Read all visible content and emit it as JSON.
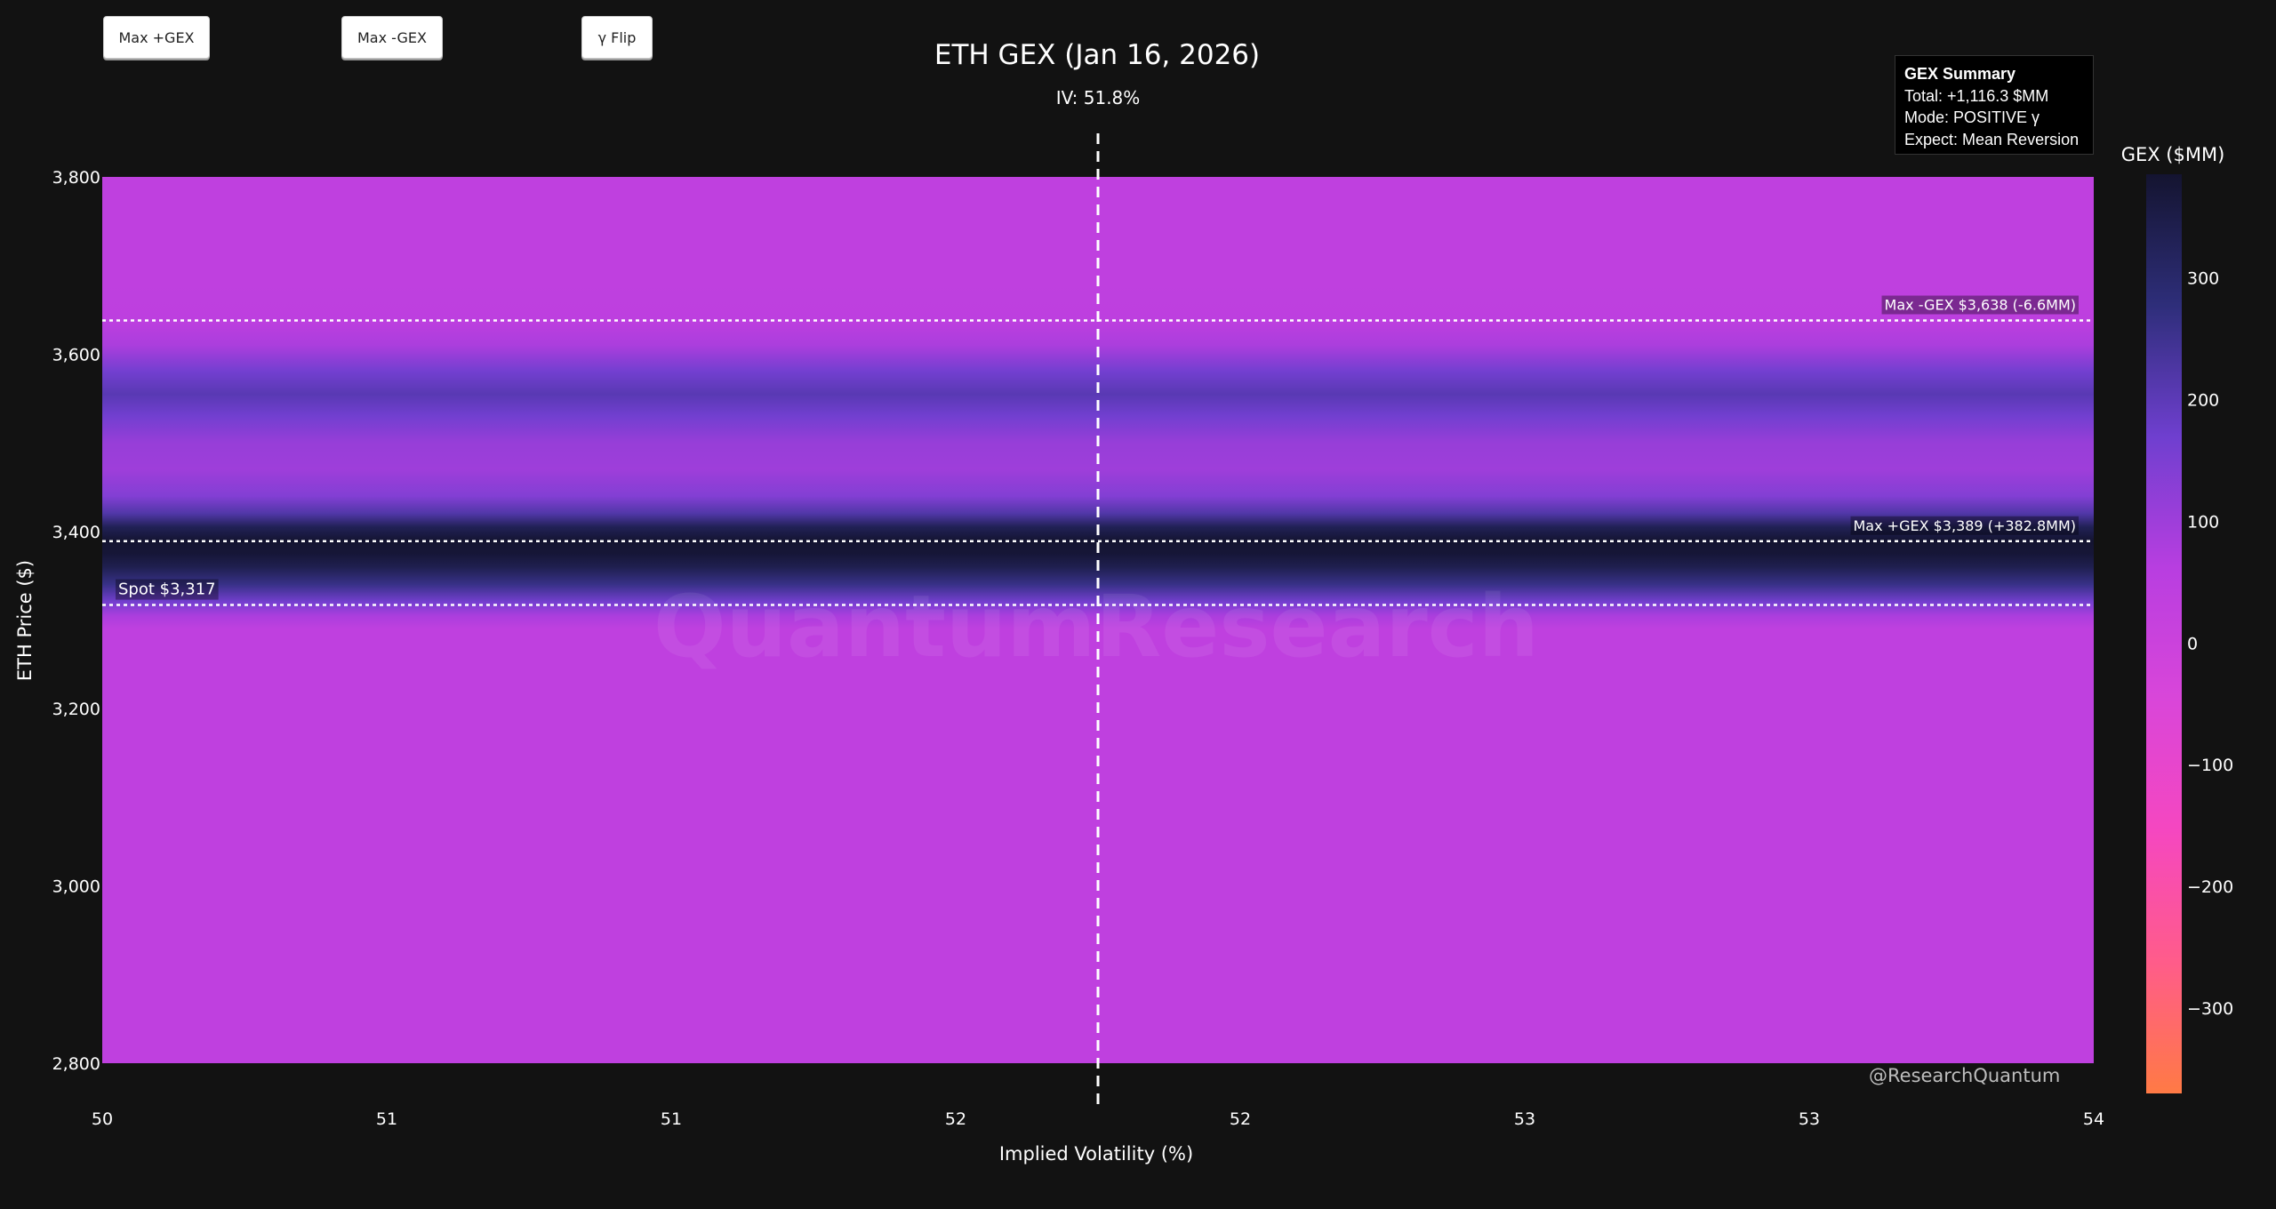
{
  "toolbar": {
    "max_pos_label": "Max +GEX",
    "max_neg_label": "Max -GEX",
    "flip_label": "γ Flip"
  },
  "summary": {
    "header": "GEX Summary",
    "total": "Total: +1,116.3 $MM",
    "mode": "Mode: POSITIVE γ",
    "expect": "Expect: Mean Reversion"
  },
  "watermark": {
    "center": "QuantumResearch",
    "handle": "@ResearchQuantum"
  },
  "colorbar": {
    "title": "GEX ($MM)",
    "ticks": [
      "300",
      "200",
      "100",
      "0",
      "−100",
      "−200",
      "−300"
    ],
    "tick_values": [
      300,
      200,
      100,
      0,
      -100,
      -200,
      -300
    ],
    "range": [
      -370,
      385
    ],
    "colors": [
      "#ff7a45",
      "#ff5c8a",
      "#f547c0",
      "#d946d9",
      "#b83ee0",
      "#6f3fcf",
      "#2e2e7a",
      "#141430"
    ]
  },
  "chart_data": {
    "type": "heatmap",
    "title": "ETH GEX (Jan 16, 2026)",
    "subtitle": "IV: 51.8%",
    "xlabel": "Implied Volatility (%)",
    "ylabel": "ETH Price ($)",
    "xlim": [
      50.0,
      53.5
    ],
    "ylim": [
      2800,
      3800
    ],
    "x_tick_labels": [
      "50",
      "51",
      "51",
      "52",
      "52",
      "53",
      "53",
      "54"
    ],
    "y_ticks": [
      2800,
      3000,
      3200,
      3400,
      3600,
      3800
    ],
    "y_tick_labels": [
      "2,800",
      "3,000",
      "3,200",
      "3,400",
      "3,600",
      "3,800"
    ],
    "iv_marker": 51.75,
    "gex_profile": [
      {
        "price": 2800,
        "gex": 40
      },
      {
        "price": 3290,
        "gex": 40
      },
      {
        "price": 3305,
        "gex": 80
      },
      {
        "price": 3320,
        "gex": 160
      },
      {
        "price": 3340,
        "gex": 260
      },
      {
        "price": 3360,
        "gex": 340
      },
      {
        "price": 3375,
        "gex": 375
      },
      {
        "price": 3389,
        "gex": 383
      },
      {
        "price": 3405,
        "gex": 330
      },
      {
        "price": 3420,
        "gex": 220
      },
      {
        "price": 3440,
        "gex": 140
      },
      {
        "price": 3470,
        "gex": 100
      },
      {
        "price": 3500,
        "gex": 110
      },
      {
        "price": 3530,
        "gex": 165
      },
      {
        "price": 3555,
        "gex": 205
      },
      {
        "price": 3580,
        "gex": 165
      },
      {
        "price": 3610,
        "gex": 80
      },
      {
        "price": 3638,
        "gex": 45
      },
      {
        "price": 3680,
        "gex": 40
      },
      {
        "price": 3800,
        "gex": 40
      }
    ],
    "levels": [
      {
        "name": "Max -GEX",
        "price": 3638,
        "label": "Max -GEX $3,638 (-6.6MM)"
      },
      {
        "name": "Max +GEX",
        "price": 3389,
        "label": "Max +GEX $3,389 (+382.8MM)"
      },
      {
        "name": "Spot",
        "price": 3317,
        "label": "Spot $3,317"
      }
    ]
  }
}
